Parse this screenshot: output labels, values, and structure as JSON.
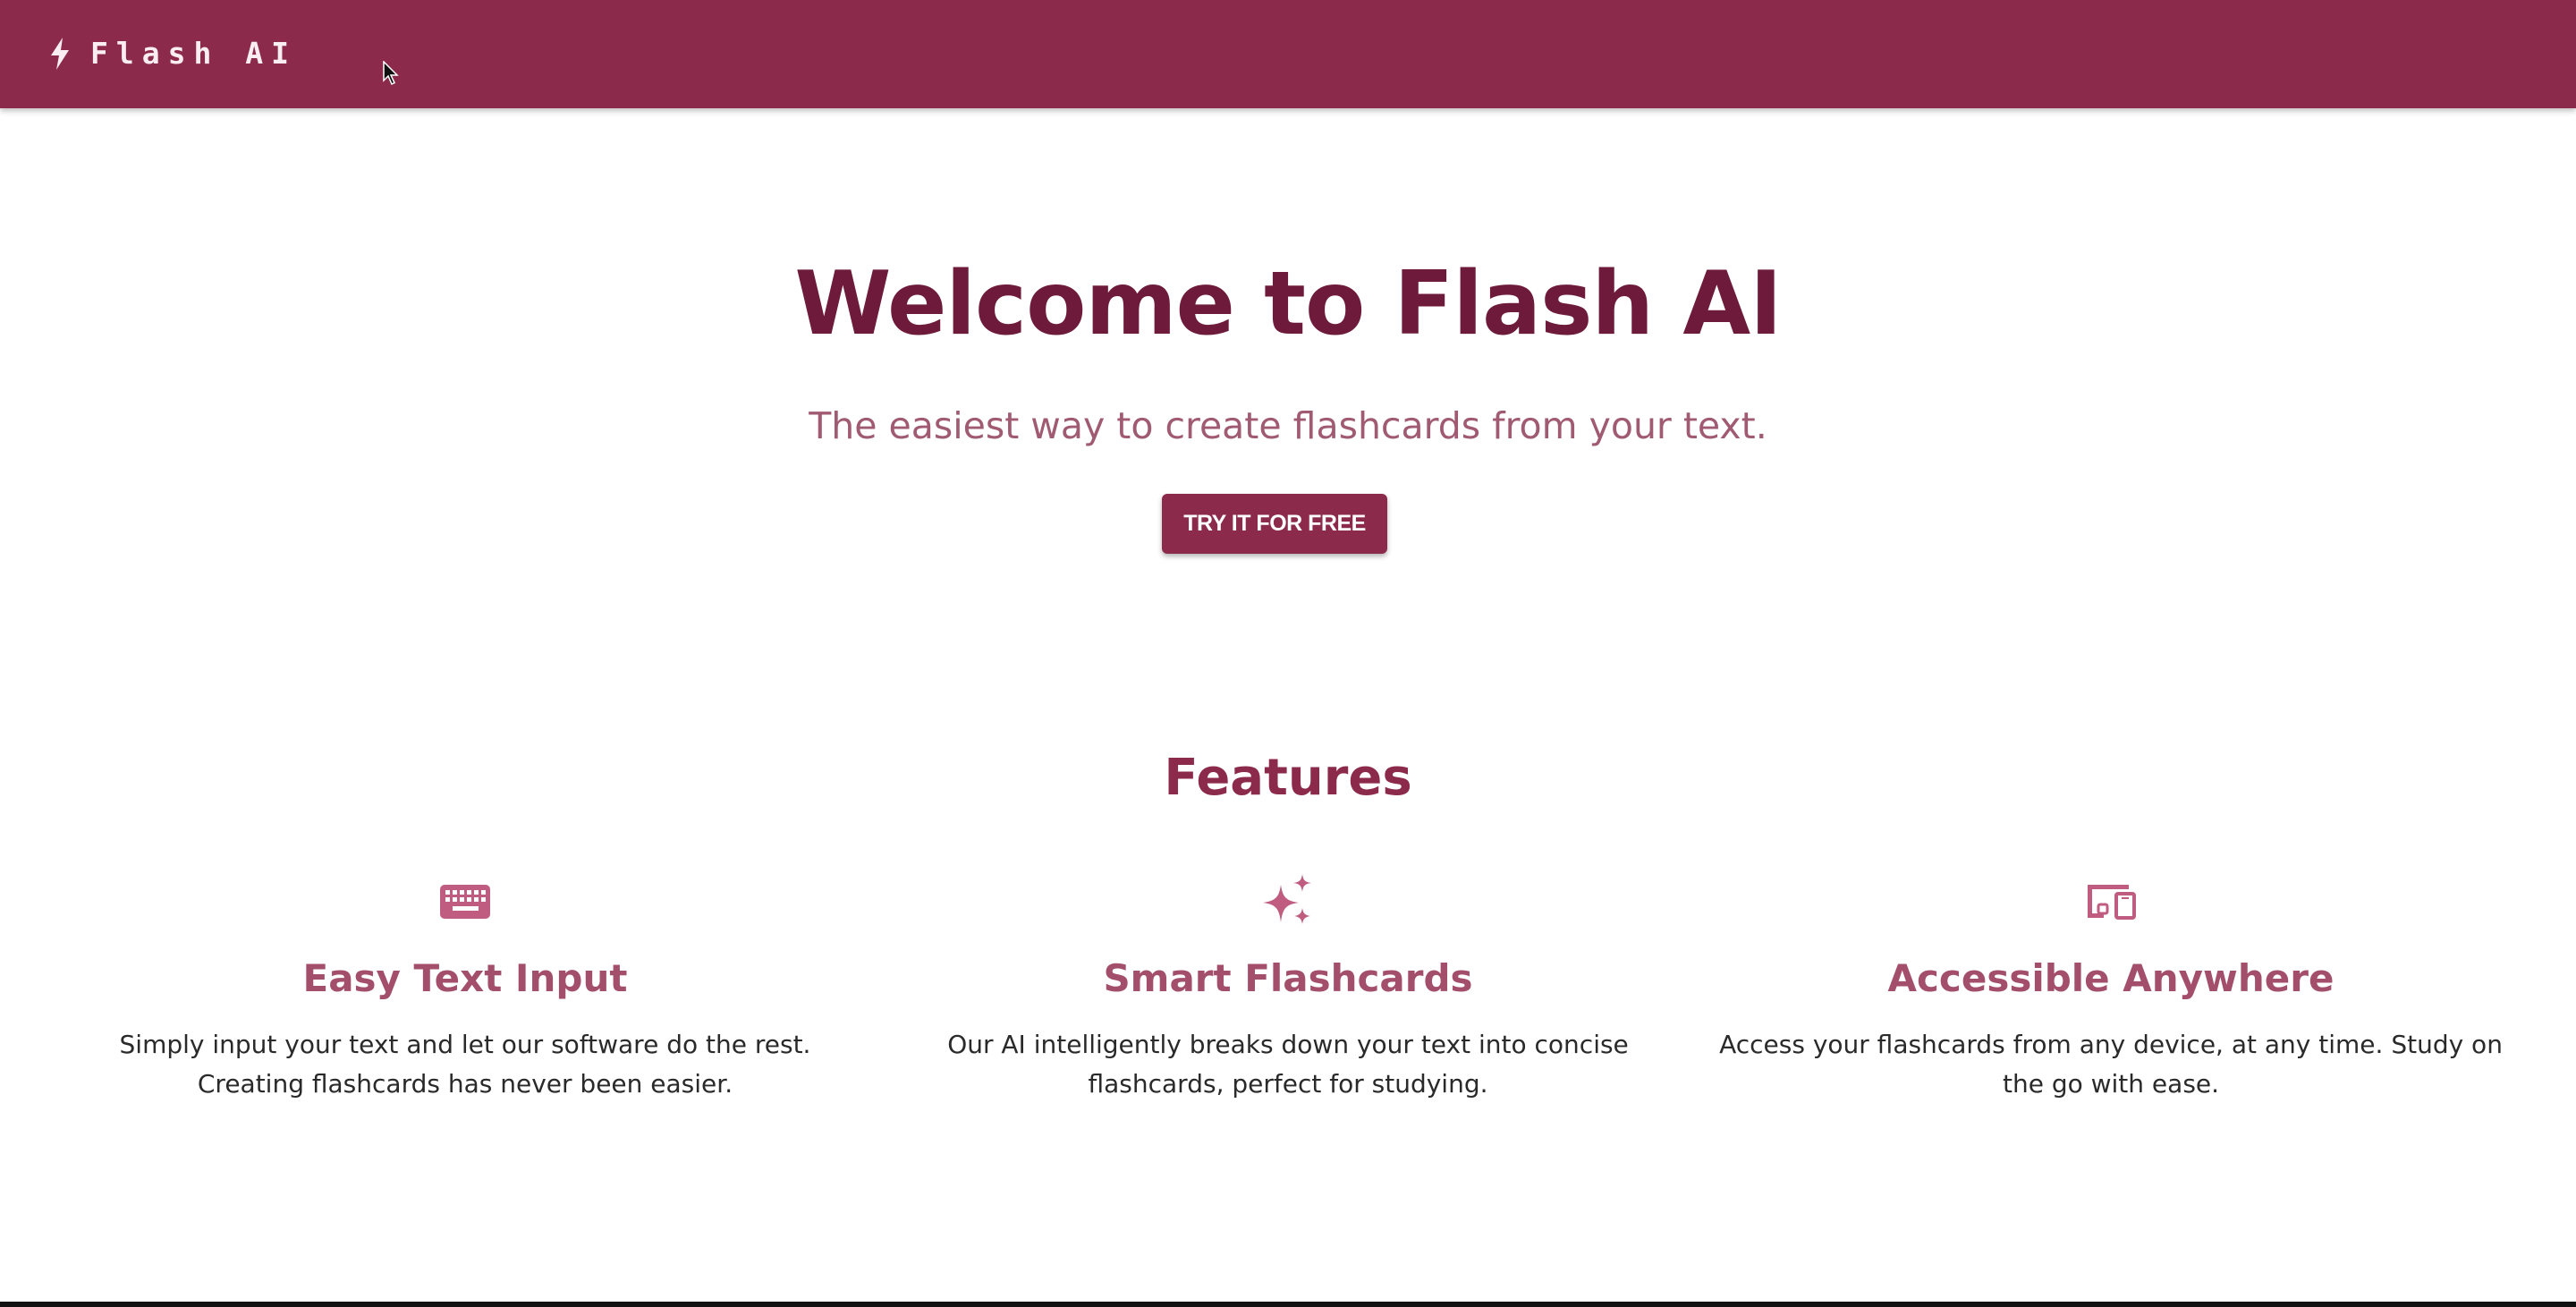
{
  "colors": {
    "primary": "#8c2a4c",
    "hero_title": "#6e1a3a",
    "subtitle": "#a05a72",
    "feature_title": "#a34f6c",
    "feature_icon": "#c05c80"
  },
  "appbar": {
    "icon": "bolt-icon",
    "title": "Flash AI"
  },
  "hero": {
    "title": "Welcome to Flash AI",
    "subtitle": "The easiest way to create flashcards from your text.",
    "cta_label": "TRY IT FOR FREE"
  },
  "features": {
    "heading": "Features",
    "items": [
      {
        "icon": "keyboard-icon",
        "title": "Easy Text Input",
        "description": "Simply input your text and let our software do the rest. Creating flashcards has never been easier."
      },
      {
        "icon": "sparkles-icon",
        "title": "Smart Flashcards",
        "description": "Our AI intelligently breaks down your text into concise flashcards, perfect for studying."
      },
      {
        "icon": "devices-icon",
        "title": "Accessible Anywhere",
        "description": "Access your flashcards from any device, at any time. Study on the go with ease."
      }
    ]
  }
}
